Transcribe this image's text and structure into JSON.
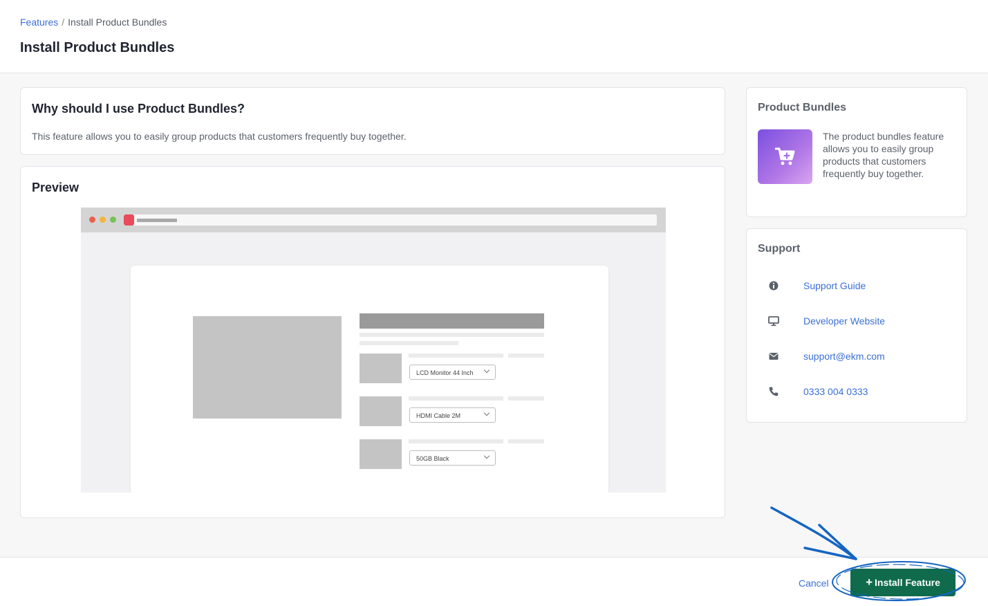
{
  "breadcrumb": {
    "parent": "Features",
    "separator": "/",
    "current": "Install Product Bundles"
  },
  "page_title": "Install Product Bundles",
  "why": {
    "title": "Why should I use Product Bundles?",
    "description": "This feature allows you to easily group products that customers frequently buy together."
  },
  "preview": {
    "title": "Preview",
    "rows": [
      {
        "select": "LCD Monitor 44 Inch"
      },
      {
        "select": "HDMI Cable 2M"
      },
      {
        "select": "50GB Black"
      }
    ]
  },
  "info": {
    "title": "Product Bundles",
    "icon": "cart-plus-icon",
    "description": "The product bundles feature allows you to easily group products that customers frequently buy together."
  },
  "support": {
    "title": "Support",
    "items": [
      {
        "icon": "info-icon",
        "label": "Support Guide"
      },
      {
        "icon": "monitor-icon",
        "label": "Developer Website"
      },
      {
        "icon": "envelope-icon",
        "label": "support@ekm.com"
      },
      {
        "icon": "phone-icon",
        "label": "0333 004 0333"
      }
    ]
  },
  "footer": {
    "cancel_label": "Cancel",
    "install_label": "Install Feature"
  },
  "colors": {
    "accent_link": "#3b6fd8",
    "install_button": "#0f6b4c",
    "annotation": "#1565c0"
  }
}
